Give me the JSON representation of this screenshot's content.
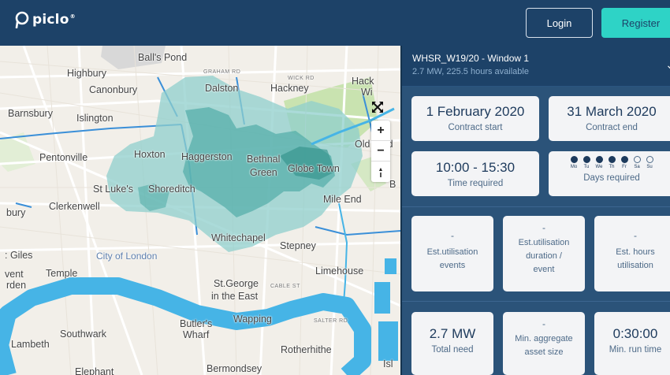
{
  "header": {
    "logo_text": "piclo",
    "logo_reg": "®",
    "login_label": "Login",
    "register_label": "Register"
  },
  "map": {
    "labels": {
      "balls_pond": "Ball's Pond",
      "highbury": "Highbury",
      "graham_rd": "GRAHAM RD",
      "wick_rd": "WICK RD",
      "hack": "Hack",
      "wi": "Wi",
      "canonbury": "Canonbury",
      "dalston": "Dalston",
      "hackney": "Hackney",
      "barnsbury": "Barnsbury",
      "islington": "Islington",
      "old_ford": "Old Ford",
      "pentonville": "Pentonville",
      "hoxton": "Hoxton",
      "haggerston": "Haggerston",
      "bethnal": "Bethnal",
      "green": "Green",
      "globe_town": "Globe Town",
      "st_lukes": "St Luke's",
      "shoreditch": "Shoreditch",
      "b": "B",
      "mile_end": "Mile End",
      "clerkenwell": "Clerkenwell",
      "bury": "bury",
      "whitechapel": "Whitechapel",
      "giles": ": Giles",
      "city_of_london": "City of London",
      "stepney": "Stepney",
      "vent": "vent",
      "temple": "Temple",
      "rden": "rden",
      "limehouse": "Limehouse",
      "st_george": "St.George",
      "in_the_east": "in the East",
      "cable_st": "CABLE ST",
      "butlers": "Butler's",
      "wharf": "Wharf",
      "wapping": "Wapping",
      "salter_rd": "SALTER RD",
      "southwark": "Southwark",
      "lambeth": "Lambeth",
      "rotherhithe": "Rotherhithe",
      "elephant": "Elephant",
      "bermondsey": "Bermondsey",
      "isl": "Isl"
    },
    "controls": {
      "zoom_in": "+",
      "zoom_out": "−",
      "compass": "▲"
    }
  },
  "panel": {
    "title": "WHSR_W19/20 - Window 1",
    "subtitle": "2.7 MW, 225.5 hours available",
    "contract_start_value": "1 February 2020",
    "contract_start_label": "Contract start",
    "contract_end_value": "31 March 2020",
    "contract_end_label": "Contract end",
    "time_value": "10:00 - 15:30",
    "time_label": "Time required",
    "days_label": "Days required",
    "days": [
      {
        "abbr": "Mo",
        "on": true
      },
      {
        "abbr": "Tu",
        "on": true
      },
      {
        "abbr": "We",
        "on": true
      },
      {
        "abbr": "Th",
        "on": true
      },
      {
        "abbr": "Fr",
        "on": true
      },
      {
        "abbr": "Sa",
        "on": false
      },
      {
        "abbr": "Su",
        "on": false
      }
    ],
    "est_events_value": "-",
    "est_events_label_1": "Est.utilisation",
    "est_events_label_2": "events",
    "est_duration_value": "-",
    "est_duration_label_1": "Est.utilisation",
    "est_duration_label_2": "duration /",
    "est_duration_label_3": "event",
    "est_hours_value": "-",
    "est_hours_label_1": "Est. hours",
    "est_hours_label_2": "utilisation",
    "total_need_value": "2.7 MW",
    "total_need_label": "Total need",
    "min_agg_value": "-",
    "min_agg_label_1": "Min. aggregate",
    "min_agg_label_2": "asset size",
    "min_run_value": "0:30:00",
    "min_run_label": "Min. run time"
  },
  "colors": {
    "nav_bg": "#1d4268",
    "register_bg": "#2ed3c6",
    "zone_fill": "#8fcfcc",
    "zone_dark": "#4aa9a4",
    "water": "#46b4e6",
    "park": "#c9e3b0"
  }
}
